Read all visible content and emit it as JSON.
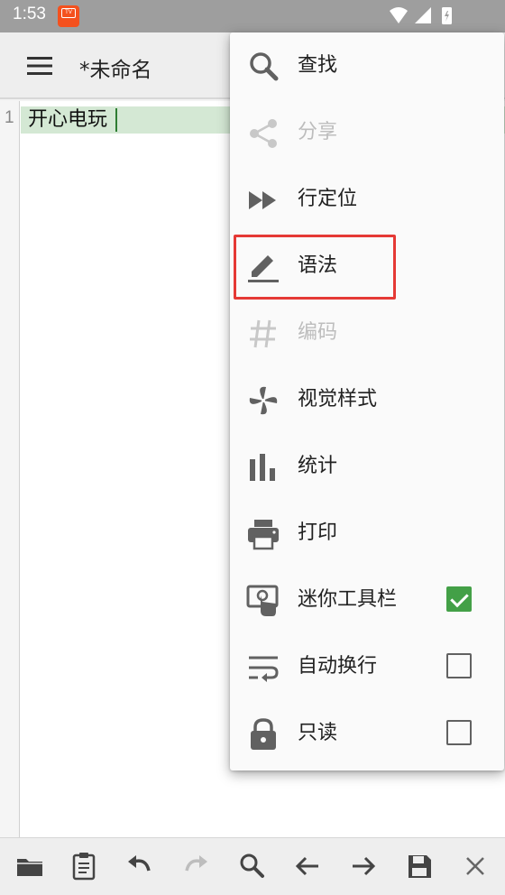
{
  "statusbar": {
    "time": "1:53",
    "app_icon_text": "TV"
  },
  "toolbar": {
    "title": "*未命名"
  },
  "editor": {
    "line_number": "1",
    "line_text": "开心电玩"
  },
  "menu": {
    "items": [
      {
        "label": "查找",
        "icon": "search-icon",
        "enabled": true
      },
      {
        "label": "分享",
        "icon": "share-icon",
        "enabled": false
      },
      {
        "label": "行定位",
        "icon": "fast-forward-icon",
        "enabled": true
      },
      {
        "label": "语法",
        "icon": "highlighter-icon",
        "enabled": true
      },
      {
        "label": "编码",
        "icon": "hash-icon",
        "enabled": false
      },
      {
        "label": "视觉样式",
        "icon": "pinwheel-icon",
        "enabled": true
      },
      {
        "label": "统计",
        "icon": "bar-chart-icon",
        "enabled": true
      },
      {
        "label": "打印",
        "icon": "printer-icon",
        "enabled": true
      },
      {
        "label": "迷你工具栏",
        "icon": "touch-screen-icon",
        "enabled": true,
        "checked": true
      },
      {
        "label": "自动换行",
        "icon": "wrap-icon",
        "enabled": true,
        "checked": false
      },
      {
        "label": "只读",
        "icon": "lock-icon",
        "enabled": true,
        "checked": false
      }
    ]
  },
  "bottombar": {
    "icons": [
      "folder-icon",
      "clipboard-icon",
      "undo-icon",
      "redo-icon",
      "search-icon",
      "arrow-left-icon",
      "arrow-right-icon",
      "save-icon",
      "close-icon"
    ]
  },
  "colors": {
    "accent": "#43a047",
    "highlight_outline": "#e53935",
    "line_highlight": "#d4e8d4",
    "statusbar": "#9e9e9e"
  }
}
